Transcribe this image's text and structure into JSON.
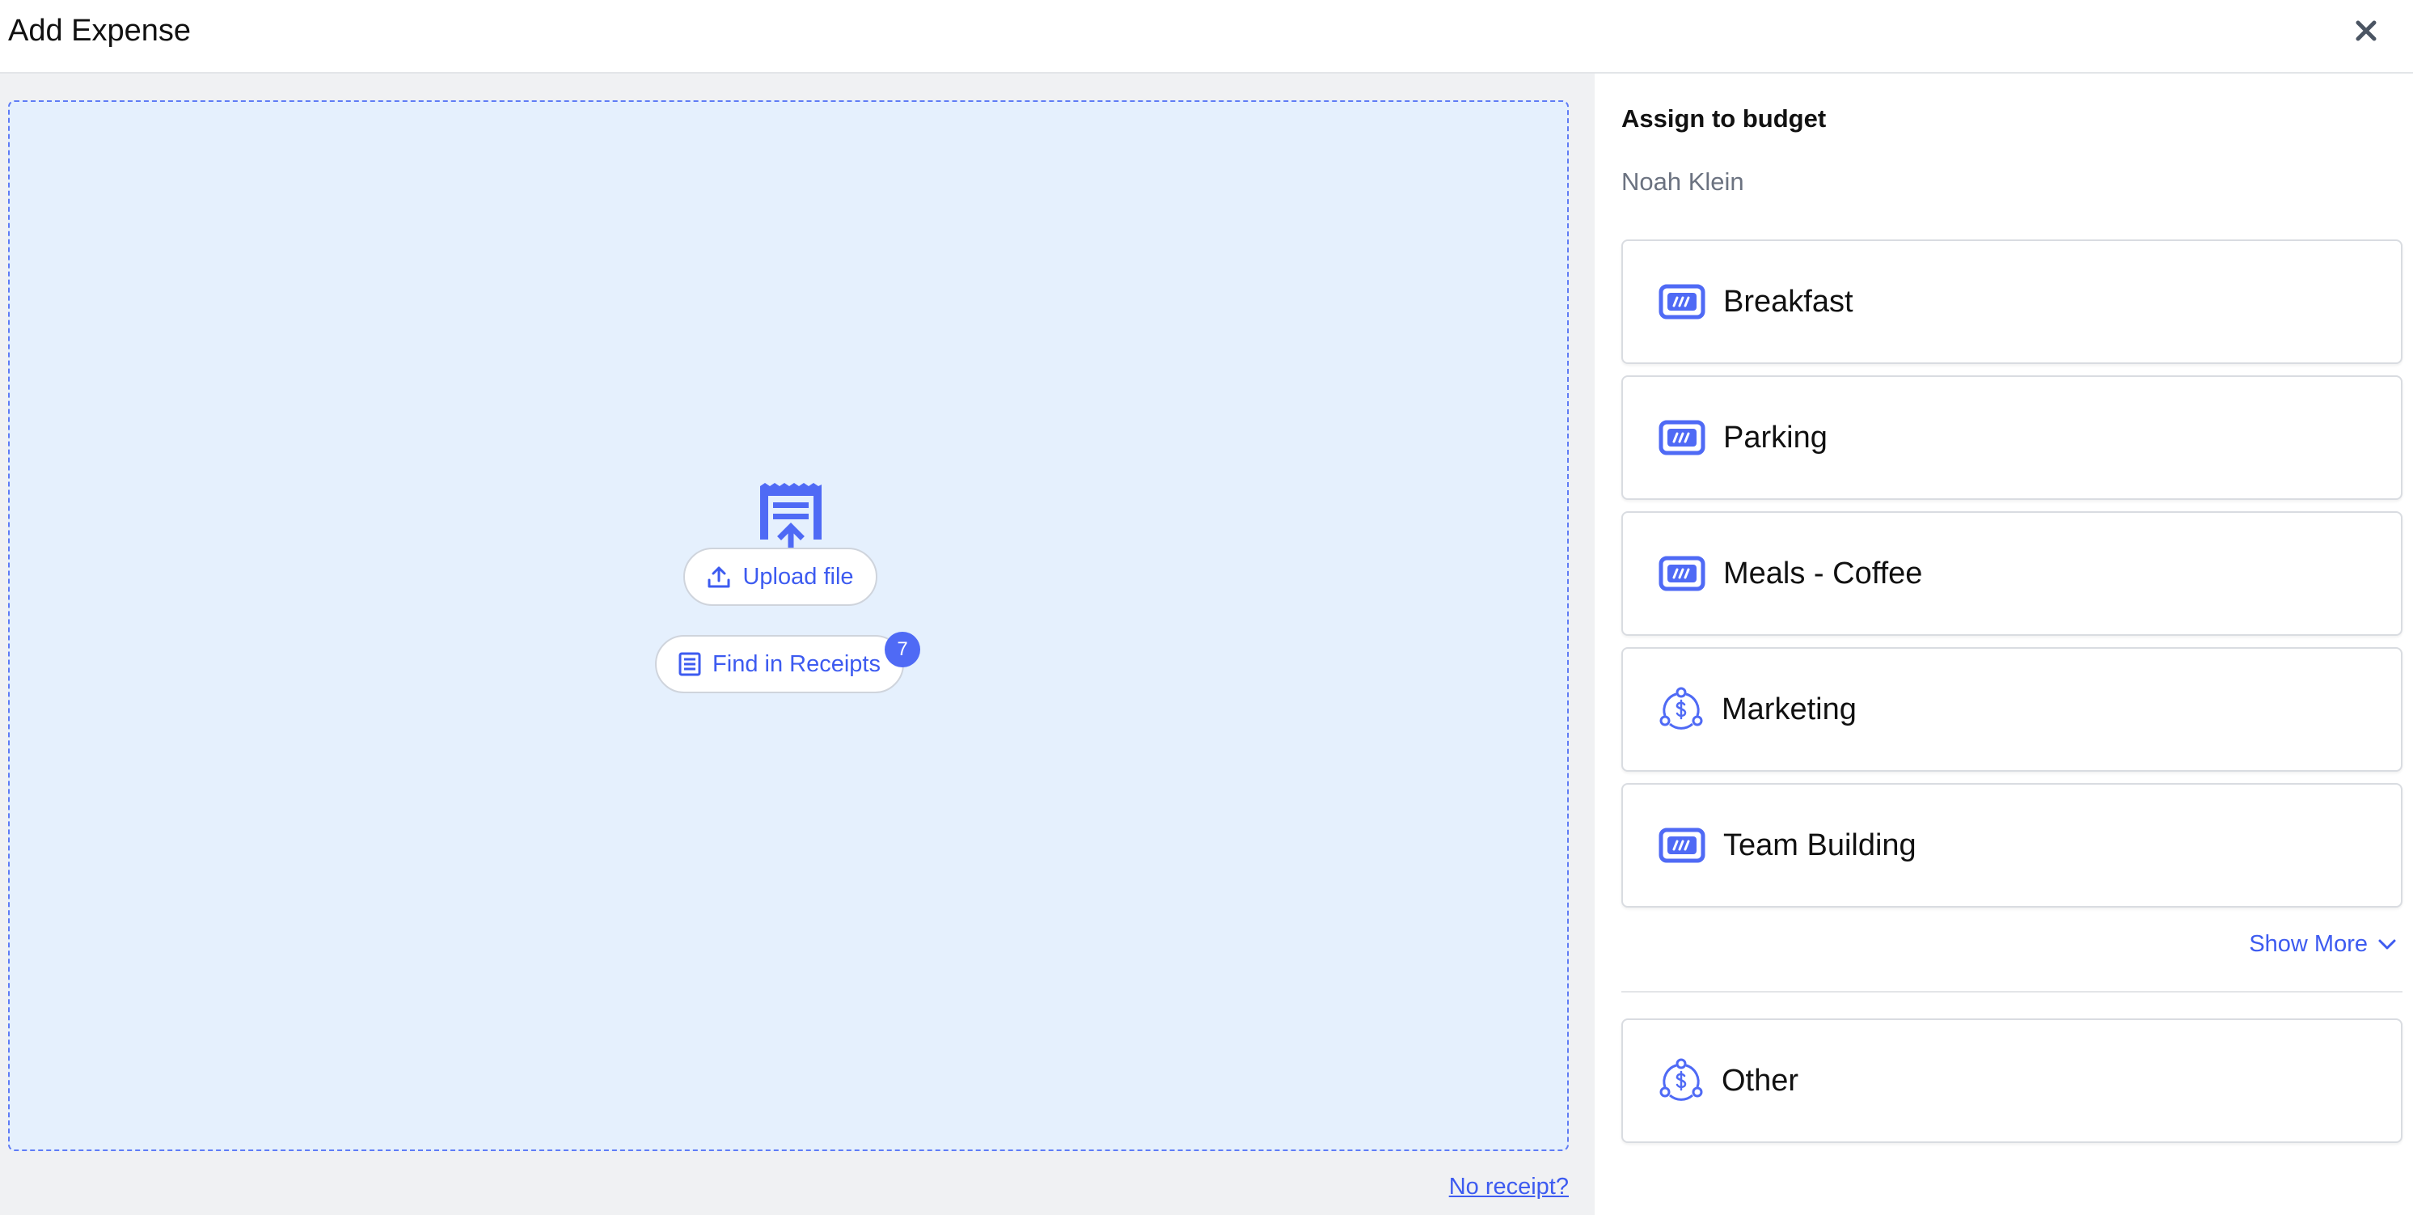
{
  "header": {
    "title": "Add Expense",
    "close_icon": "close-icon"
  },
  "upload": {
    "illustration_icon": "receipt-upload-icon",
    "upload_label": "Upload file",
    "upload_icon": "upload-icon",
    "receipts_label": "Find in Receipts",
    "receipts_icon": "receipts-list-icon",
    "receipts_count": "7",
    "no_receipt_label": "No receipt?"
  },
  "budget": {
    "title": "Assign to budget",
    "person": "Noah Klein",
    "items": [
      {
        "label": "Breakfast",
        "icon": "money-card-icon"
      },
      {
        "label": "Parking",
        "icon": "money-card-icon"
      },
      {
        "label": "Meals - Coffee",
        "icon": "money-card-icon"
      },
      {
        "label": "Marketing",
        "icon": "dollar-cycle-icon"
      },
      {
        "label": "Team Building",
        "icon": "money-card-icon"
      }
    ],
    "show_more_label": "Show More",
    "other": {
      "label": "Other",
      "icon": "dollar-cycle-icon"
    }
  },
  "colors": {
    "accent": "#3d5bf0",
    "badge": "#4f6af5",
    "dropzone_bg": "#e5f0fd",
    "left_bg": "#f0f1f3"
  }
}
